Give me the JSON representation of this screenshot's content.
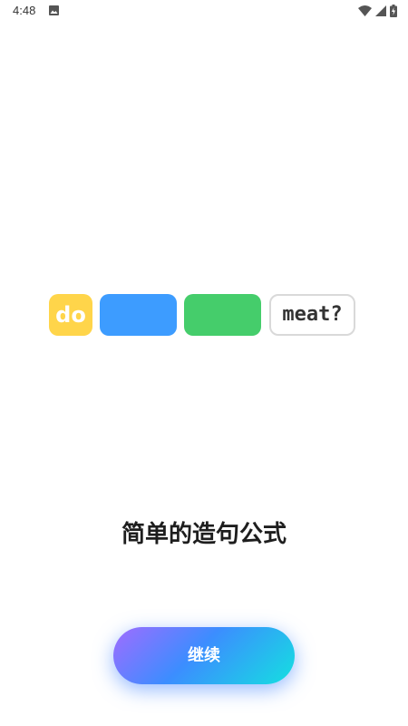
{
  "status_bar": {
    "time": "4:48",
    "icons": [
      "image-icon",
      "wifi-icon",
      "signal-icon",
      "battery-icon"
    ]
  },
  "sentence_blocks": [
    {
      "text": "do",
      "color": "#ffd54a"
    },
    {
      "text": "",
      "color": "#3d9cff"
    },
    {
      "text": "",
      "color": "#45cd6b"
    },
    {
      "text": "meat?",
      "color": "#ffffff"
    }
  ],
  "title": "简单的造句公式",
  "continue_button": {
    "label": "继续"
  },
  "colors": {
    "button_gradient_start": "#a06cff",
    "button_gradient_mid": "#3c8dff",
    "button_gradient_end": "#14e0e0"
  }
}
